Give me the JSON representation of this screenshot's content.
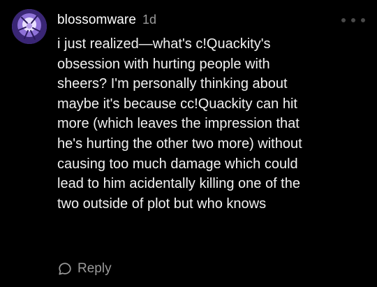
{
  "comment": {
    "avatar_icon": "user-avatar",
    "username": "blossomware",
    "timestamp": "1d",
    "more_icon": "more-dots-icon",
    "body_lines": [
      "i just realized—what's c!Quackity's",
      "obsession with hurting people with",
      "sheers? I'm personally thinking about",
      "maybe it's because cc!Quackity can hit",
      "more (which leaves the impression that",
      "he's hurting the other two more) without",
      "causing too much damage which could",
      "lead to him acidentally killing one of the",
      "two outside of plot but who knows"
    ],
    "reply_icon": "speech-bubble-icon",
    "reply_label": "Reply"
  },
  "colors": {
    "background": "#000000",
    "text_primary": "#ffffff",
    "text_secondary": "#9a9a9a",
    "more_dots": "#4a4a4a"
  }
}
